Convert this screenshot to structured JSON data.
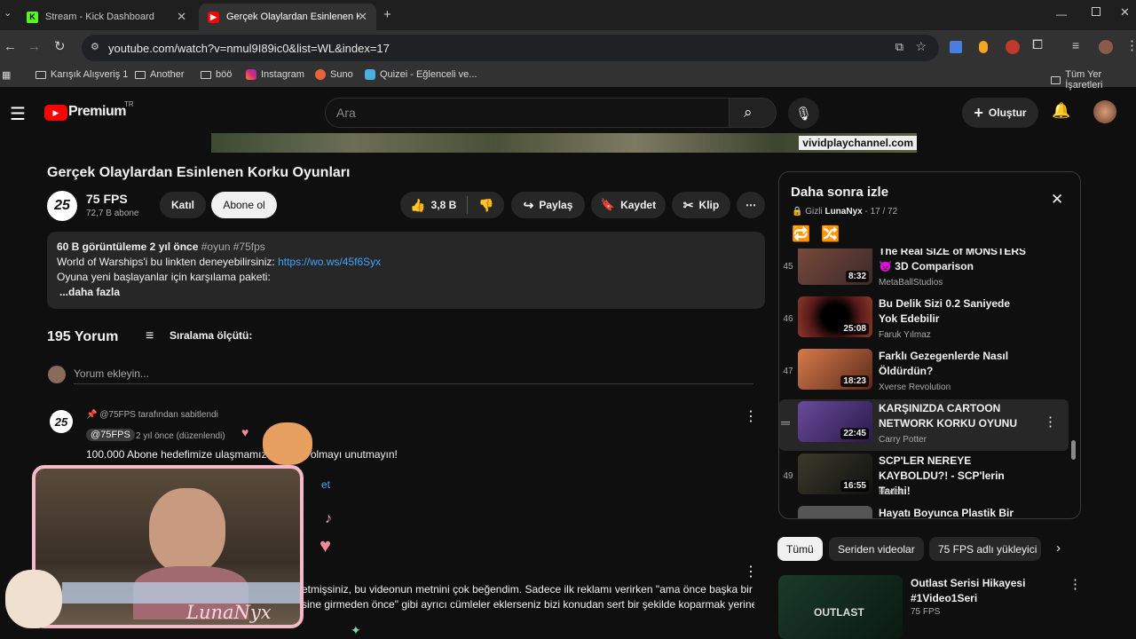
{
  "browser": {
    "tabs": [
      {
        "title": "Stream - Kick Dashboard",
        "active": false
      },
      {
        "title": "Gerçek Olaylardan Esinlenen Ko",
        "active": true
      }
    ],
    "url": "youtube.com/watch?v=nmul9I89ic0&list=WL&index=17",
    "bookmarks": [
      "Karışık Alışveriş 1",
      "Another",
      "böö",
      "Instagram",
      "Suno",
      "Quizei - Eğlenceli ve...",
      "Tüm Yer İşaretleri"
    ]
  },
  "header": {
    "brand": "Premium",
    "region": "TR",
    "search_placeholder": "Ara",
    "create_label": "Oluştur"
  },
  "video": {
    "overlay_text": "vividplaychannel.com",
    "title": "Gerçek Olaylardan Esinlenen Korku Oyunları"
  },
  "channel": {
    "avatar_text": "25",
    "name": "75 FPS",
    "subs": "72,7 B abone",
    "join_label": "Katıl",
    "subscribe_label": "Abone ol"
  },
  "actions": {
    "likes": "3,8 B",
    "share": "Paylaş",
    "save": "Kaydet",
    "clip": "Klip"
  },
  "description": {
    "meta": "60 B görüntüleme  2 yıl önce",
    "tags": "#oyun #75fps",
    "line1": "World of Warships'i bu linkten deneyebilirsiniz:",
    "link": "https://wo.ws/45f6Syx",
    "line2": "Oyuna yeni başlayanlar için karşılama paketi:",
    "more": "...daha fazla"
  },
  "comments": {
    "count": "195 Yorum",
    "sort": "Sıralama ölçütü:",
    "add_placeholder": "Yorum ekleyin...",
    "pinned": "@75FPS tarafından sabitlendi",
    "author": "@75FPS",
    "time": "2 yıl önce (düzenlendi)",
    "text1_a": "100.000 Abone hedefimize ulaşmamız",
    "text1_b": "e olmayı unutmayın!",
    "text1_c": "et",
    "text2_a": "etmişsiniz, bu videonun metnini çok beğendim. Sadece ilk reklamı verirken \"ama önce başka bir",
    "text2_b": "sine girmeden önce\" gibi ayrıcı cümleler eklerseniz bizi konudan sert bir şekilde koparmak yerine"
  },
  "playlist": {
    "title": "Daha sonra izle",
    "privacy": "Gizli",
    "owner": "LunaNyx",
    "position": "- 17 / 72",
    "items": [
      {
        "num": "45",
        "title": "The Real SIZE of MONSTERS 👿 3D Comparison",
        "channel": "MetaBallStudios",
        "duration": "8:32",
        "thumb": "#6a4a3a"
      },
      {
        "num": "46",
        "title": "Bu Delik Sizi 0.2 Saniyede Yok Edebilir",
        "channel": "Faruk Yılmaz",
        "duration": "25:08",
        "thumb": "#3a1e1e"
      },
      {
        "num": "47",
        "title": "Farklı Gezegenlerde Nasıl Öldürdün?",
        "channel": "Xverse Revolution",
        "duration": "18:23",
        "thumb": "#c0623a"
      },
      {
        "num": "",
        "title": "KARŞINIZDA CARTOON NETWORK KORKU OYUNU",
        "channel": "Carry Potter",
        "duration": "22:45",
        "thumb": "#5a3a7a"
      },
      {
        "num": "49",
        "title": "SCP'LER NEREYE KAYBOLDU?! - SCP'lerin Tarihi!",
        "channel": "Hodek",
        "duration": "16:55",
        "thumb": "#2a2a22"
      },
      {
        "num": "",
        "title": "Hayatı Boyunca Plastik Bir",
        "channel": "",
        "duration": "",
        "thumb": "#444"
      }
    ]
  },
  "chips": [
    "Tümü",
    "Seriden videolar",
    "75 FPS adlı yükleyici"
  ],
  "recommended": {
    "title": "Outlast Serisi Hikayesi #1Video1Seri",
    "channel": "75 FPS",
    "thumb_text": "OUTLAST"
  },
  "overlay": {
    "streamer_name": "LunaNyx"
  }
}
